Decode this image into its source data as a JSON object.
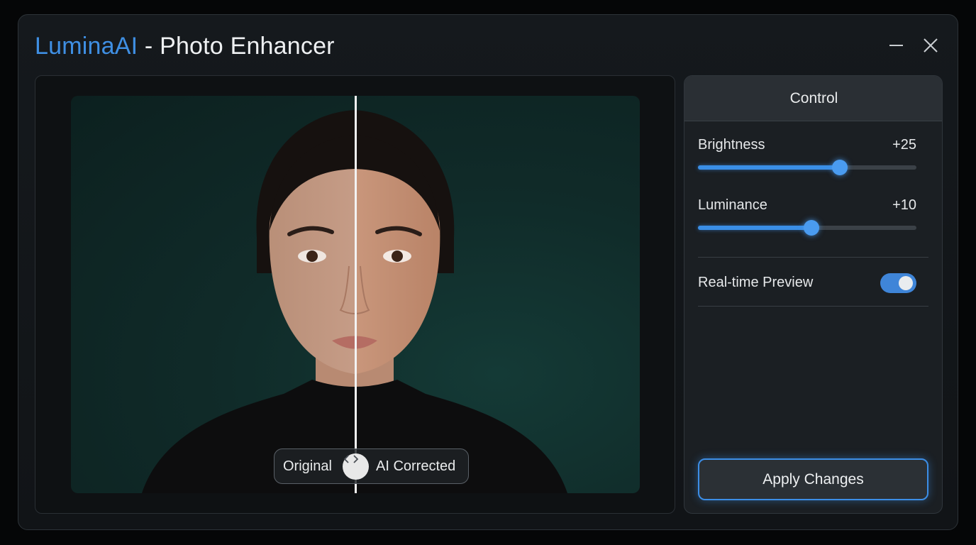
{
  "app": {
    "brand": "LuminaAI",
    "title_rest": " - Photo Enhancer",
    "minimize_icon": "minimize-icon",
    "close_icon": "close-icon"
  },
  "compare": {
    "left_label": "Original",
    "right_label": "AI Corrected",
    "handle_icon": "chevrons-left-right-icon"
  },
  "panel": {
    "header": "Control",
    "brightness": {
      "label": "Brightness",
      "value": "+25",
      "level": 0.65
    },
    "luminance": {
      "label": "Luminance",
      "value": "+10",
      "level": 0.52
    },
    "realtime": {
      "label": "Real-time Preview",
      "enabled": true
    },
    "apply_label": "Apply Changes"
  },
  "colors": {
    "accent": "#3f8fe3",
    "background": "#050607",
    "window": "#15191d"
  }
}
